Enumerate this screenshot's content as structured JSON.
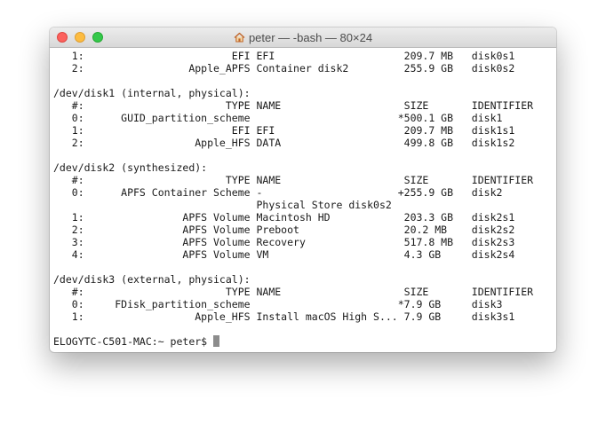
{
  "window": {
    "title": "peter — -bash — 80×24",
    "home_icon": "home-icon"
  },
  "terminal": {
    "lines": [
      "   1:                        EFI EFI                     209.7 MB   disk0s1",
      "   2:                 Apple_APFS Container disk2         255.9 GB   disk0s2",
      "",
      "/dev/disk1 (internal, physical):",
      "   #:                       TYPE NAME                    SIZE       IDENTIFIER",
      "   0:      GUID_partition_scheme                        *500.1 GB   disk1",
      "   1:                        EFI EFI                     209.7 MB   disk1s1",
      "   2:                  Apple_HFS DATA                    499.8 GB   disk1s2",
      "",
      "/dev/disk2 (synthesized):",
      "   #:                       TYPE NAME                    SIZE       IDENTIFIER",
      "   0:      APFS Container Scheme -                      +255.9 GB   disk2",
      "                                 Physical Store disk0s2",
      "   1:                APFS Volume Macintosh HD            203.3 GB   disk2s1",
      "   2:                APFS Volume Preboot                 20.2 MB    disk2s2",
      "   3:                APFS Volume Recovery                517.8 MB   disk2s3",
      "   4:                APFS Volume VM                      4.3 GB     disk2s4",
      "",
      "/dev/disk3 (external, physical):",
      "   #:                       TYPE NAME                    SIZE       IDENTIFIER",
      "   0:     FDisk_partition_scheme                        *7.9 GB     disk3",
      "   1:                  Apple_HFS Install macOS High S... 7.9 GB     disk3s1",
      "",
      "ELOGYTC-C501-MAC:~ peter$ "
    ]
  }
}
